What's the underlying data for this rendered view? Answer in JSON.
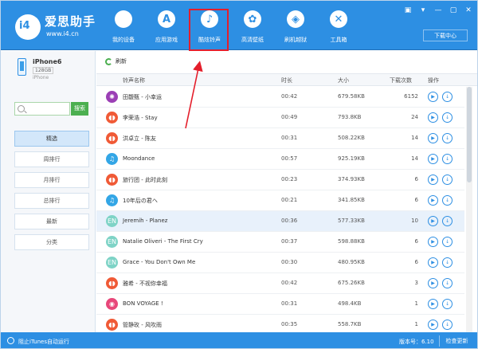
{
  "brand": {
    "logo_text": "i4",
    "name": "爱思助手",
    "url": "www.i4.cn"
  },
  "nav": [
    {
      "label": "我的设备",
      "icon": "apple-icon",
      "glyph": ""
    },
    {
      "label": "应用游戏",
      "icon": "app-store-icon",
      "glyph": "A"
    },
    {
      "label": "酷炫铃声",
      "icon": "bell-icon",
      "glyph": "♪"
    },
    {
      "label": "高清壁纸",
      "icon": "flower-icon",
      "glyph": "✿"
    },
    {
      "label": "刷机越狱",
      "icon": "box-icon",
      "glyph": "◈"
    },
    {
      "label": "工具箱",
      "icon": "tools-icon",
      "glyph": "✕"
    }
  ],
  "window": {
    "controls": [
      "▣",
      "▾",
      "—",
      "▢",
      "✕"
    ],
    "download_center": "下载中心"
  },
  "device": {
    "name": "iPhone6",
    "storage": "128GB",
    "model": "iPhone"
  },
  "search": {
    "placeholder": "",
    "button": "搜索"
  },
  "sidebar": {
    "items": [
      "精选",
      "周排行",
      "月排行",
      "总排行",
      "最新",
      "分类"
    ],
    "active_index": 0
  },
  "main": {
    "refresh": "刷新",
    "columns": {
      "name": "铃声名称",
      "duration": "时长",
      "size": "大小",
      "downloads": "下载次数",
      "actions": "操作"
    },
    "rows": [
      {
        "name": "田馥甄 - 小幸运",
        "duration": "00:42",
        "size": "679.58KB",
        "downloads": "6152",
        "color": "#9b3fb5",
        "glyph": "✺"
      },
      {
        "name": "李荣浩 - Stay",
        "duration": "00:49",
        "size": "793.8KB",
        "downloads": "24",
        "color": "#f05a36",
        "glyph": "◖◗"
      },
      {
        "name": "洪卓立 - 陈友",
        "duration": "00:31",
        "size": "508.22KB",
        "downloads": "14",
        "color": "#f05a36",
        "glyph": "◖◗"
      },
      {
        "name": "Moondance",
        "duration": "00:57",
        "size": "925.19KB",
        "downloads": "14",
        "color": "#33a6e6",
        "glyph": "♫"
      },
      {
        "name": "旅行团 - 此时此刻",
        "duration": "00:23",
        "size": "374.93KB",
        "downloads": "6",
        "color": "#f05a36",
        "glyph": "◖◗"
      },
      {
        "name": "10年后の君へ",
        "duration": "00:21",
        "size": "341.85KB",
        "downloads": "6",
        "color": "#33a6e6",
        "glyph": "♫"
      },
      {
        "name": "Jeremih - Planez",
        "duration": "00:36",
        "size": "577.33KB",
        "downloads": "10",
        "color": "#7ed3c6",
        "glyph": "EN"
      },
      {
        "name": "Natalie Oliveri - The First Cry",
        "duration": "00:37",
        "size": "598.88KB",
        "downloads": "6",
        "color": "#7ed3c6",
        "glyph": "EN"
      },
      {
        "name": "Grace - You Don't Own Me",
        "duration": "00:30",
        "size": "480.95KB",
        "downloads": "6",
        "color": "#7ed3c6",
        "glyph": "EN"
      },
      {
        "name": "雅希 - 不视你幸福",
        "duration": "00:42",
        "size": "675.26KB",
        "downloads": "3",
        "color": "#f05a36",
        "glyph": "◖◗"
      },
      {
        "name": "BON VOYAGE !",
        "duration": "00:31",
        "size": "498.4KB",
        "downloads": "1",
        "color": "#e8477a",
        "glyph": "◉"
      },
      {
        "name": "管静玫 - 风吹雨",
        "duration": "00:35",
        "size": "558.7KB",
        "downloads": "1",
        "color": "#f05a36",
        "glyph": "◖◗"
      }
    ],
    "highlight_row": 6
  },
  "status": {
    "itunes": "阻止iTunes自动运行",
    "version": "版本号：6.10",
    "update": "检查更新"
  }
}
